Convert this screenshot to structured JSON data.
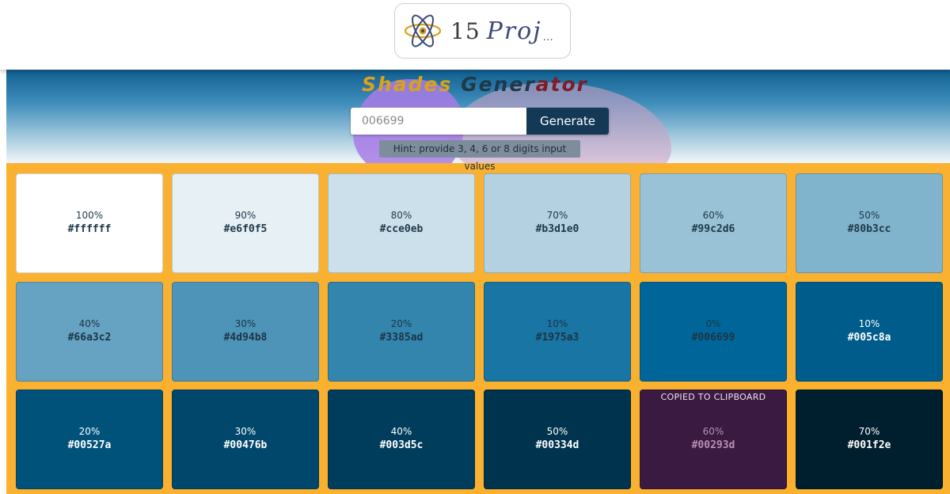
{
  "logo": {
    "num": "15",
    "script": "Proj",
    "dots": "..."
  },
  "title": {
    "part1": "Shades",
    "part2": "Gener",
    "part3": "ator"
  },
  "search": {
    "placeholder": "006699",
    "button": "Generate"
  },
  "hint": "Hint: provide 3, 4, 6 or 8 digits input values",
  "colors": {
    "accent": "#fbb130",
    "button": "#143957"
  },
  "tiles": [
    {
      "pct": "100%",
      "hex": "#ffffff",
      "bg": "#ffffff",
      "fg": "#20394a"
    },
    {
      "pct": "90%",
      "hex": "#e6f0f5",
      "bg": "#e6f0f5",
      "fg": "#20394a"
    },
    {
      "pct": "80%",
      "hex": "#cce0eb",
      "bg": "#cce0eb",
      "fg": "#20394a"
    },
    {
      "pct": "70%",
      "hex": "#b3d1e0",
      "bg": "#b3d1e0",
      "fg": "#20394a"
    },
    {
      "pct": "60%",
      "hex": "#99c2d6",
      "bg": "#99c2d6",
      "fg": "#20394a"
    },
    {
      "pct": "50%",
      "hex": "#80b3cc",
      "bg": "#80b3cc",
      "fg": "#20394a"
    },
    {
      "pct": "40%",
      "hex": "#66a3c2",
      "bg": "#66a3c2",
      "fg": "#1d3446"
    },
    {
      "pct": "30%",
      "hex": "#4d94b8",
      "bg": "#4d94b8",
      "fg": "#1d3446"
    },
    {
      "pct": "20%",
      "hex": "#3385ad",
      "bg": "#3385ad",
      "fg": "#1d3446"
    },
    {
      "pct": "10%",
      "hex": "#1975a3",
      "bg": "#1975a3",
      "fg": "#1d3446"
    },
    {
      "pct": "0%",
      "hex": "#006699",
      "bg": "#006699",
      "fg": "#1d3446"
    },
    {
      "pct": "10%",
      "hex": "#005c8a",
      "bg": "#005c8a",
      "fg": "#ffffff"
    },
    {
      "pct": "20%",
      "hex": "#00527a",
      "bg": "#00527a",
      "fg": "#ffffff"
    },
    {
      "pct": "30%",
      "hex": "#00476b",
      "bg": "#00476b",
      "fg": "#ffffff"
    },
    {
      "pct": "40%",
      "hex": "#003d5c",
      "bg": "#003d5c",
      "fg": "#ffffff"
    },
    {
      "pct": "50%",
      "hex": "#00334d",
      "bg": "#00334d",
      "fg": "#ffffff"
    },
    {
      "pct": "60%",
      "hex": "#00293d",
      "bg": "#3a1a40",
      "fg": "#b98fb4",
      "copied": "COPIED TO CLIPBOARD"
    },
    {
      "pct": "70%",
      "hex": "#001f2e",
      "bg": "#001f2e",
      "fg": "#ffffff"
    }
  ]
}
